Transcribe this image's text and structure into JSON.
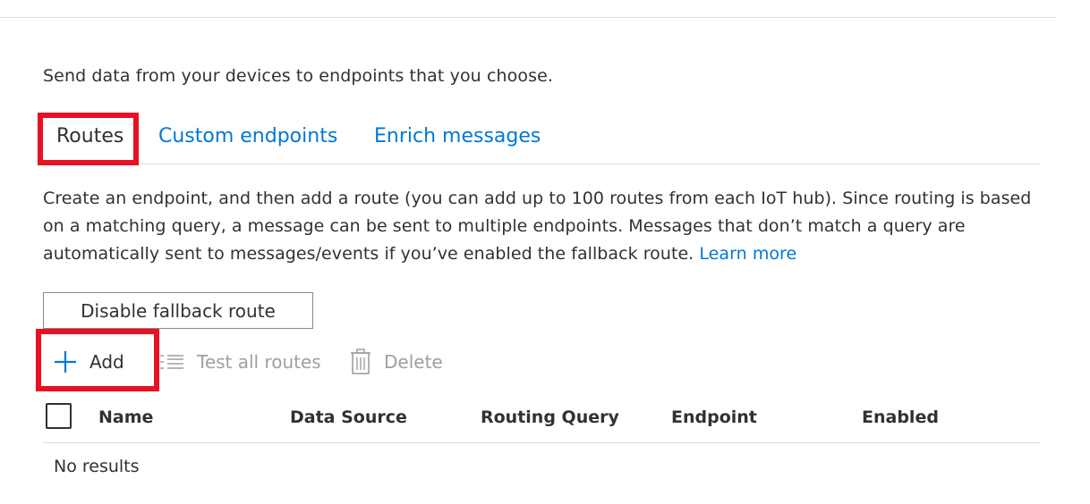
{
  "intro_text": "Send data from your devices to endpoints that you choose.",
  "tabs": [
    {
      "label": "Routes",
      "selected": true
    },
    {
      "label": "Custom endpoints",
      "selected": false
    },
    {
      "label": "Enrich messages",
      "selected": false
    }
  ],
  "description": {
    "text": "Create an endpoint, and then add a route (you can add up to 100 routes from each IoT hub). Since routing is based on a matching query, a message can be sent to multiple endpoints. Messages that don’t match a query are automatically sent to messages/events if you’ve enabled the fallback route.",
    "link": "Learn more"
  },
  "fallback_button": {
    "label": "Disable fallback route"
  },
  "toolbar": {
    "add": {
      "label": "Add",
      "icon": "plus-icon",
      "enabled": true
    },
    "test": {
      "label": "Test all routes",
      "icon": "list-icon",
      "enabled": false
    },
    "delete": {
      "label": "Delete",
      "icon": "trash-icon",
      "enabled": false
    }
  },
  "table": {
    "columns": [
      "Name",
      "Data Source",
      "Routing Query",
      "Endpoint",
      "Enabled"
    ],
    "empty_text": "No results"
  },
  "colors": {
    "link": "#0078d4",
    "highlight": "#e81123",
    "disabled": "#a19f9d",
    "text": "#323130"
  }
}
